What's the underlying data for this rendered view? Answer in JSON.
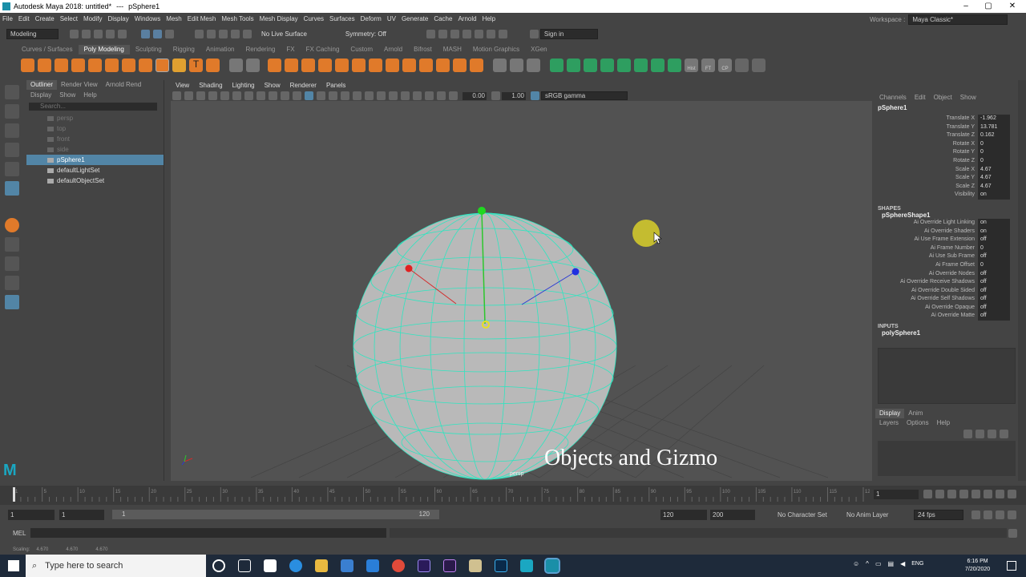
{
  "title": {
    "app": "Autodesk Maya 2018: untitled*",
    "sep": "---",
    "object": "pSphere1"
  },
  "menu": [
    "File",
    "Edit",
    "Create",
    "Select",
    "Modify",
    "Display",
    "Windows",
    "Mesh",
    "Edit Mesh",
    "Mesh Tools",
    "Mesh Display",
    "Curves",
    "Surfaces",
    "Deform",
    "UV",
    "Generate",
    "Cache",
    "Arnold",
    "Help"
  ],
  "workspace": {
    "label": "Workspace :",
    "value": "Maya Classic*"
  },
  "toolbar": {
    "menuset": "Modeling",
    "live": "No Live Surface",
    "symmetry": "Symmetry: Off",
    "signin": "Sign in"
  },
  "shelf_tabs": [
    "Curves / Surfaces",
    "Poly Modeling",
    "Sculpting",
    "Rigging",
    "Animation",
    "Rendering",
    "FX",
    "FX Caching",
    "Custom",
    "Arnold",
    "Bifrost",
    "MASH",
    "Motion Graphics",
    "XGen"
  ],
  "shelf_labels": {
    "hist": "Hist",
    "ft": "FT",
    "cp": "CP"
  },
  "outliner": {
    "tabs": [
      "Outliner",
      "Render View",
      "Arnold Rend"
    ],
    "menu": [
      "Display",
      "Show",
      "Help"
    ],
    "search": "Search...",
    "items": [
      "persp",
      "top",
      "front",
      "side",
      "pSphere1",
      "defaultLightSet",
      "defaultObjectSet"
    ]
  },
  "viewport": {
    "menu": [
      "View",
      "Shading",
      "Lighting",
      "Show",
      "Renderer",
      "Panels"
    ],
    "val1": "0.00",
    "val2": "1.00",
    "colorspace": "sRGB gamma",
    "camera": "persp",
    "overlay": "Objects and Gizmo"
  },
  "channel": {
    "menu": [
      "Channels",
      "Edit",
      "Object",
      "Show"
    ],
    "object": "pSphere1",
    "attrs": [
      [
        "Translate X",
        "-1.962"
      ],
      [
        "Translate Y",
        "13.781"
      ],
      [
        "Translate Z",
        "0.162"
      ],
      [
        "Rotate X",
        "0"
      ],
      [
        "Rotate Y",
        "0"
      ],
      [
        "Rotate Z",
        "0"
      ],
      [
        "Scale X",
        "4.67"
      ],
      [
        "Scale Y",
        "4.67"
      ],
      [
        "Scale Z",
        "4.67"
      ],
      [
        "Visibility",
        "on"
      ]
    ],
    "shapes_title": "SHAPES",
    "shape": "pSphereShape1",
    "shape_attrs": [
      [
        "Ai Override Light Linking",
        "on"
      ],
      [
        "Ai Override Shaders",
        "on"
      ],
      [
        "Ai Use Frame Extension",
        "off"
      ],
      [
        "Ai Frame Number",
        "0"
      ],
      [
        "Ai Use Sub Frame",
        "off"
      ],
      [
        "Ai Frame Offset",
        "0"
      ],
      [
        "Ai Override Nodes",
        "off"
      ],
      [
        "Ai Override Receive Shadows",
        "off"
      ],
      [
        "Ai Override Double Sided",
        "off"
      ],
      [
        "Ai Override Self Shadows",
        "off"
      ],
      [
        "Ai Override Opaque",
        "off"
      ],
      [
        "Ai Override Matte",
        "off"
      ]
    ],
    "inputs_title": "INPUTS",
    "input": "polySphere1"
  },
  "layers": {
    "tabs": [
      "Display",
      "Anim"
    ],
    "menu": [
      "Layers",
      "Options",
      "Help"
    ]
  },
  "timeline": {
    "ticks": [
      "1",
      "5",
      "10",
      "15",
      "20",
      "25",
      "30",
      "35",
      "40",
      "45",
      "50",
      "55",
      "60",
      "65",
      "70",
      "75",
      "80",
      "85",
      "90",
      "95",
      "100",
      "105",
      "110",
      "115",
      "120"
    ],
    "current": "1"
  },
  "range": {
    "start": "1",
    "start2": "1",
    "inner_start": "1",
    "inner_end": "120",
    "end": "120",
    "end2": "200",
    "charset": "No Character Set",
    "animlayer": "No Anim Layer",
    "fps": "24 fps"
  },
  "cmd": {
    "label": "MEL"
  },
  "help": {
    "text": "Scaling:",
    "v1": "4.670",
    "v2": "4.670",
    "v3": "4.670"
  },
  "taskbar": {
    "search": "Type here to search",
    "time": "6:16 PM",
    "date": "7/20/2020",
    "lang": "ENG"
  }
}
